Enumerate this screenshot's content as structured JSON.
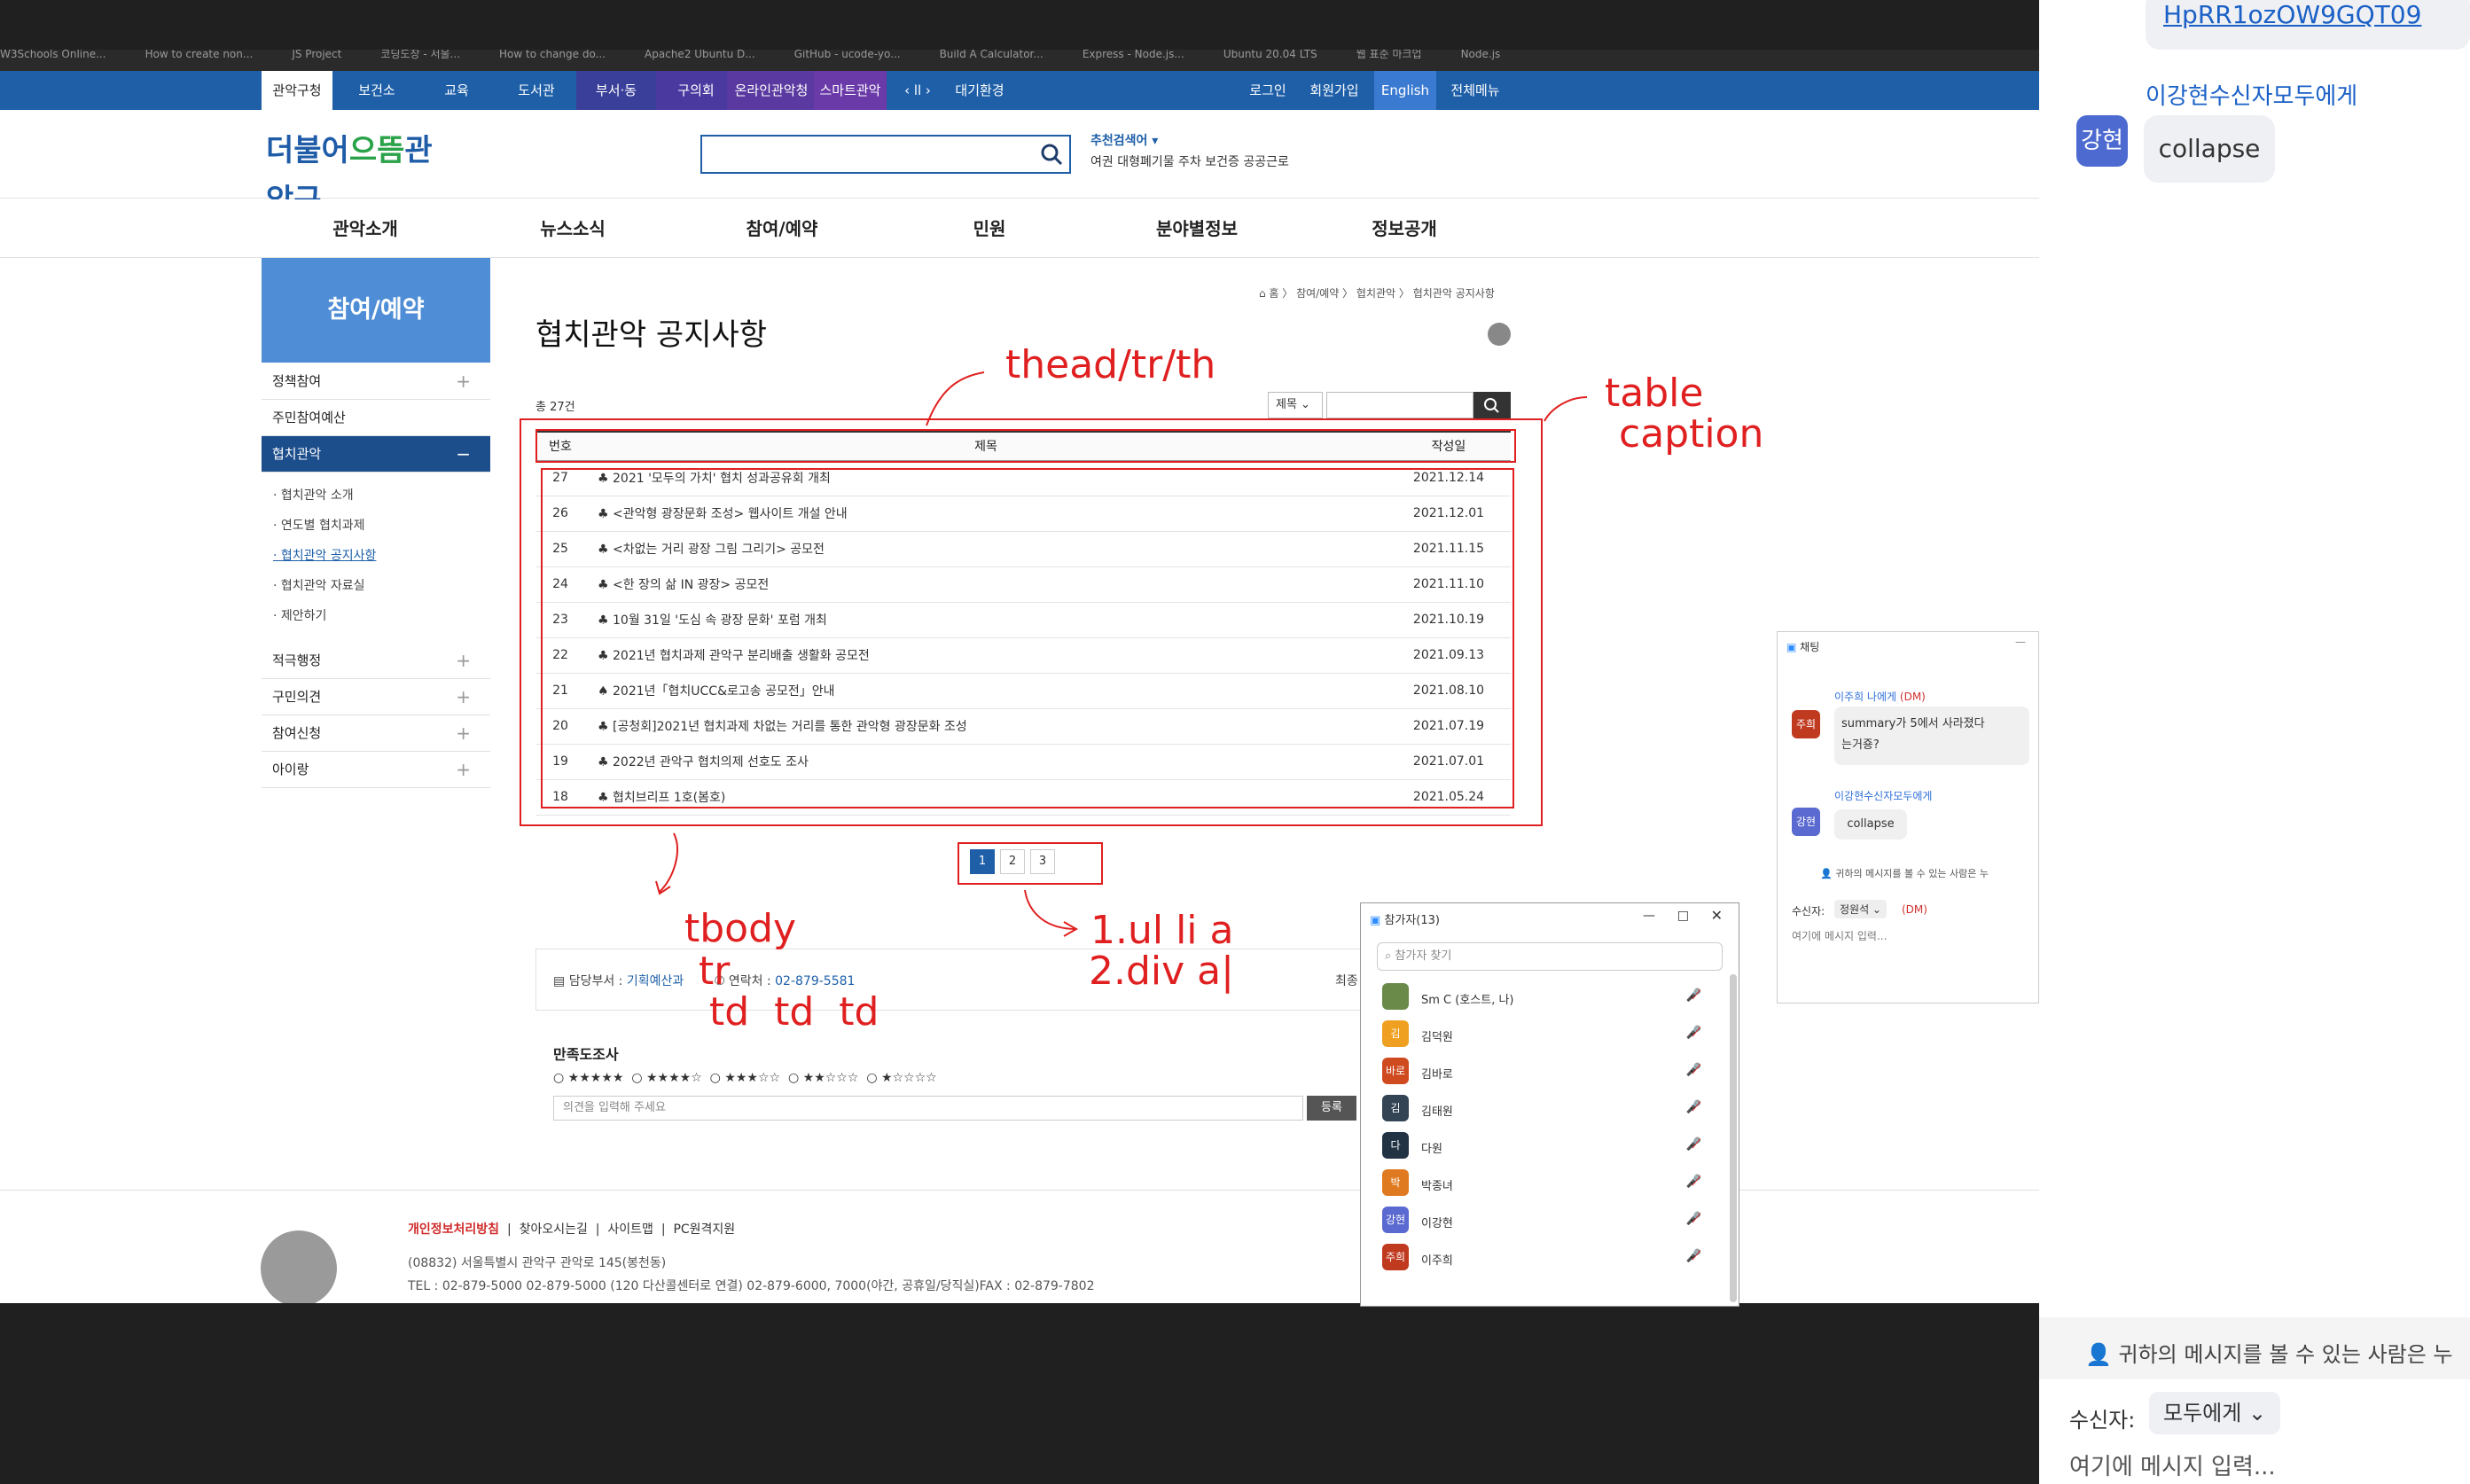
{
  "browser": {
    "bookmarks": [
      "W3Schools Online...",
      "How to create non...",
      "JS Project",
      "코딩도장 - 서울...",
      "How to change do...",
      "Apache2 Ubuntu D...",
      "GitHub - ucode-yo...",
      "Build A Calculator...",
      "Express - Node.js...",
      "Ubuntu 20.04 LTS",
      "웹 표준 마크업",
      "Node.js"
    ]
  },
  "topbar": {
    "tabs": [
      "관악구청",
      "보건소",
      "교육",
      "도서관",
      "부서·동",
      "구의회",
      "온라인관악청",
      "스마트관악"
    ],
    "ticker_controls": "‹ ll ›",
    "ticker_text": "대기환경",
    "right_links": [
      "로그인",
      "회원가입",
      "English",
      "전체메뉴"
    ]
  },
  "header": {
    "logo_text_a": "더불어",
    "logo_text_b": "으뜸",
    "logo_text_c": "관악구",
    "recommend_label": "추천검색어 ▾",
    "recommend_text": "여권  대형폐기물  주차  보건증  공공근로"
  },
  "gnb": [
    "관악소개",
    "뉴스소식",
    "참여/예약",
    "민원",
    "분야별정보",
    "정보공개"
  ],
  "lnb": {
    "title": "참여/예약",
    "items": [
      {
        "label": "정책참여",
        "pm": "+"
      },
      {
        "label": "주민참여예산",
        "pm": ""
      },
      {
        "label": "협치관악",
        "pm": "−"
      },
      {
        "label": "적극행정",
        "pm": "+"
      },
      {
        "label": "구민의견",
        "pm": "+"
      },
      {
        "label": "참여신청",
        "pm": "+"
      },
      {
        "label": "아이랑",
        "pm": "+"
      }
    ],
    "sub_items": [
      "· 협치관악 소개",
      "· 연도별 협치과제",
      "· 협치관악 공지사항",
      "· 협치관악 자료실",
      "· 제안하기"
    ]
  },
  "content": {
    "breadcrumb": "⌂ 홈 〉 참여/예약 〉 협치관악 〉 협치관악 공지사항",
    "page_title": "협치관악 공지사항",
    "total_count": "총 27건",
    "search_field": "제목 ⌄",
    "table": {
      "headers": [
        "번호",
        "제목",
        "작성일"
      ],
      "rows": [
        {
          "num": "27",
          "title": "♣ 2021 '모두의 가치' 협치 성과공유회 개최",
          "date": "2021.12.14"
        },
        {
          "num": "26",
          "title": "♣ <관악형 광장문화 조성> 웹사이트 개설 안내",
          "date": "2021.12.01"
        },
        {
          "num": "25",
          "title": "♣ <차없는 거리 광장 그림 그리기> 공모전",
          "date": "2021.11.15"
        },
        {
          "num": "24",
          "title": "♣ <한 장의 삶 IN 광장> 공모전",
          "date": "2021.11.10"
        },
        {
          "num": "23",
          "title": "♣ 10월 31일 '도심 속 광장 문화' 포럼 개최",
          "date": "2021.10.19"
        },
        {
          "num": "22",
          "title": "♣ 2021년 협치과제 관악구 분리배출 생활화 공모전",
          "date": "2021.09.13"
        },
        {
          "num": "21",
          "title": "♠ 2021년「협치UCC&로고송 공모전」안내",
          "date": "2021.08.10"
        },
        {
          "num": "20",
          "title": "♣ [공청회]2021년 협치과제 차없는 거리를 통한 관악형 광장문화 조성",
          "date": "2021.07.19"
        },
        {
          "num": "19",
          "title": "♣ 2022년 관악구 협치의제 선호도 조사",
          "date": "2021.07.01"
        },
        {
          "num": "18",
          "title": "♣ 협치브리프 1호(봄호)",
          "date": "2021.05.24"
        }
      ]
    },
    "pagination": [
      "1",
      "2",
      "3"
    ],
    "dept_label": "담당부서 :",
    "dept_value": "기획예산과",
    "contact_label": "연락처 :",
    "contact_value": "02-879-5581",
    "updated_label": "최종",
    "survey_title": "만족도조사",
    "survey_options": [
      "○ ★★★★★",
      "○ ★★★★☆",
      "○ ★★★☆☆",
      "○ ★★☆☆☆",
      "○ ★☆☆☆☆"
    ],
    "opinion_placeholder": "의견을 입력해 주세요",
    "submit_label": "등록"
  },
  "footer": {
    "links": [
      "개인정보처리방침",
      "찾아오시는길",
      "사이트맵",
      "PC원격지원"
    ],
    "address": "(08832) 서울특별시 관악구 관악로 145(봉천동)",
    "tel": "TEL : 02-879-5000  02-879-5000 (120 다산콜센터로 연결) 02-879-6000, 7000(야간, 공휴일/당직실)FAX : 02-879-7802"
  },
  "annotations": {
    "thead": "thead/tr/th",
    "caption_line1": "table",
    "caption_line2": "caption",
    "tbody_line1": "tbody",
    "tbody_line2": "tr",
    "tbody_line3": "td  td  td",
    "pager_line1": "1.ul li a",
    "pager_line2": "2.div a|",
    "color": "#e02020"
  },
  "zoom_chat_small": {
    "title": "채팅",
    "sender1": "이주희 나에게",
    "dm1": "(DM)",
    "avatar1": "주희",
    "msg1_line1": "summary가 5에서 사라졌다",
    "msg1_line2": "는거죵?",
    "sender2": "이강현수신자모두에게",
    "avatar2": "강현",
    "msg2": "collapse",
    "notice": "귀하의 메시지를 볼 수 있는 사람은 누",
    "to_label": "수신자:",
    "to_value": "정원석 ⌄",
    "to_dm": "(DM)",
    "input_placeholder": "여기에 메시지 입력..."
  },
  "zoom_participants": {
    "title": "참가자(13)",
    "search_placeholder": "참가자 찾기",
    "people": [
      {
        "avatar": "",
        "name": "Sm C (호스트, 나)",
        "color": "#6a8a4a"
      },
      {
        "avatar": "김",
        "name": "김덕원",
        "color": "#f0a020"
      },
      {
        "avatar": "바로",
        "name": "김바로",
        "color": "#d04a20"
      },
      {
        "avatar": "김",
        "name": "김태원",
        "color": "#334455"
      },
      {
        "avatar": "다",
        "name": "다원",
        "color": "#223344"
      },
      {
        "avatar": "박",
        "name": "박종녀",
        "color": "#e07a20"
      },
      {
        "avatar": "강현",
        "name": "이강현",
        "color": "#5a6ad0"
      },
      {
        "avatar": "주희",
        "name": "이주희",
        "color": "#c03a20"
      }
    ]
  },
  "zoom_chat_large": {
    "link_text": "HpRR1ozOW9GQT09",
    "sender": "이강현수신자모두에게",
    "avatar": "강현",
    "message": "collapse",
    "notice": "귀하의 메시지를 볼 수 있는 사람은 누",
    "to_label": "수신자:",
    "to_value": "모두에게 ⌄",
    "input_placeholder": "여기에 메시지 입력..."
  }
}
